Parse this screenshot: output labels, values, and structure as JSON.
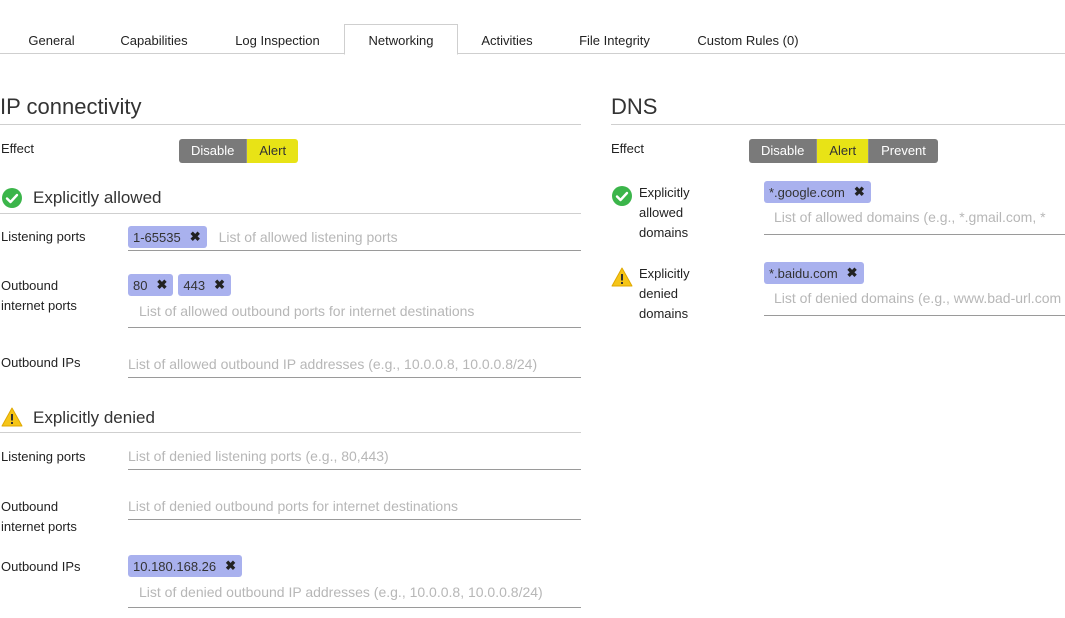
{
  "tabs": [
    {
      "label": "General"
    },
    {
      "label": "Capabilities"
    },
    {
      "label": "Log Inspection"
    },
    {
      "label": "Networking",
      "active": true
    },
    {
      "label": "Activities"
    },
    {
      "label": "File Integrity"
    },
    {
      "label": "Custom Rules (0)"
    }
  ],
  "ip": {
    "title": "IP connectivity",
    "effect_label": "Effect",
    "effect_options": [
      "Disable",
      "Alert"
    ],
    "effect_selected": "Alert",
    "allowed": {
      "title": "Explicitly allowed",
      "listening_label": "Listening ports",
      "listening_tags": [
        "1-65535"
      ],
      "listening_placeholder": "List of allowed listening ports",
      "outbound_ports_label_1": "Outbound",
      "outbound_ports_label_2": "internet ports",
      "outbound_ports_tags": [
        "80",
        "443"
      ],
      "outbound_ports_placeholder": "List of allowed outbound ports for internet destinations",
      "outbound_ips_label": "Outbound IPs",
      "outbound_ips_placeholder": "List of allowed outbound IP addresses (e.g., 10.0.0.8, 10.0.0.8/24)"
    },
    "denied": {
      "title": "Explicitly denied",
      "listening_label": "Listening ports",
      "listening_placeholder": "List of denied listening ports (e.g., 80,443)",
      "outbound_ports_label_1": "Outbound",
      "outbound_ports_label_2": "internet ports",
      "outbound_ports_placeholder": "List of denied outbound ports for internet destinations",
      "outbound_ips_label": "Outbound IPs",
      "outbound_ips_tags": [
        "10.180.168.26"
      ],
      "outbound_ips_placeholder": "List of denied outbound IP addresses (e.g., 10.0.0.8, 10.0.0.8/24)"
    }
  },
  "dns": {
    "title": "DNS",
    "effect_label": "Effect",
    "effect_options": [
      "Disable",
      "Alert",
      "Prevent"
    ],
    "effect_selected": "Alert",
    "allowed_label": [
      "Explicitly",
      "allowed",
      "domains"
    ],
    "allowed_tags": [
      "*.google.com"
    ],
    "allowed_placeholder": "List of allowed domains (e.g., *.gmail.com, *",
    "denied_label": [
      "Explicitly",
      "denied",
      "domains"
    ],
    "denied_tags": [
      "*.baidu.com"
    ],
    "denied_placeholder": "List of denied domains (e.g., www.bad-url.com"
  },
  "colors": {
    "selected": "#e8e316",
    "unselected": "#7a7a7a",
    "tag": "#a9b1ee",
    "ok_icon": "#3bb54a",
    "warn_icon": "#f5c518"
  },
  "icons": {
    "check": "check-circle-icon",
    "warn": "warning-triangle-icon",
    "remove": "close-icon"
  }
}
